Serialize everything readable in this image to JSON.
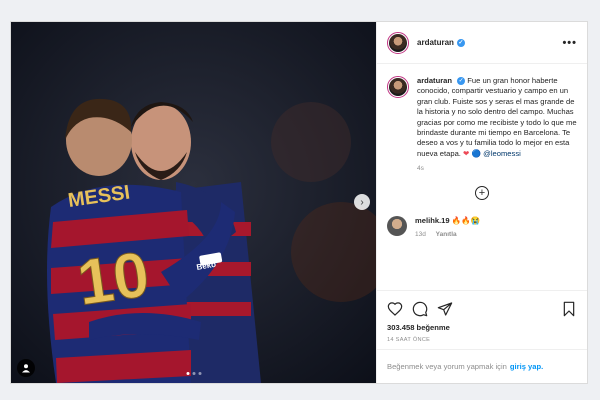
{
  "post": {
    "username": "ardaturan",
    "more_label": "•••",
    "caption_body": "Fue un gran honor haberte conocido, compartir vestuario y campo en un gran club. Fuiste sos y seras el mas grande de la historia y no solo dentro del campo. Muchas gracias por como me recibiste y todo lo que me brindaste durante mi tiempo en Barcelona. Te deseo a vos y tu familia todo lo mejor en esta nueva etapa.",
    "caption_mention": "@leomessi",
    "caption_age": "4s",
    "load_more_label": "+",
    "photo": {
      "jersey_name": "MESSI",
      "jersey_number": "10",
      "sponsor": "Beko"
    }
  },
  "comment": {
    "username": "melihk.19",
    "emoji": "🔥🔥😭",
    "age": "13d",
    "reply_label": "Yanıtla"
  },
  "engagement": {
    "likes": "303.458 beğenme",
    "time": "14 SAAT ÖNCE"
  },
  "footer": {
    "prompt": "Beğenmek veya yorum yapmak için",
    "login_link": "giriş yap."
  },
  "carousel": {
    "count": 3,
    "active": 1
  }
}
